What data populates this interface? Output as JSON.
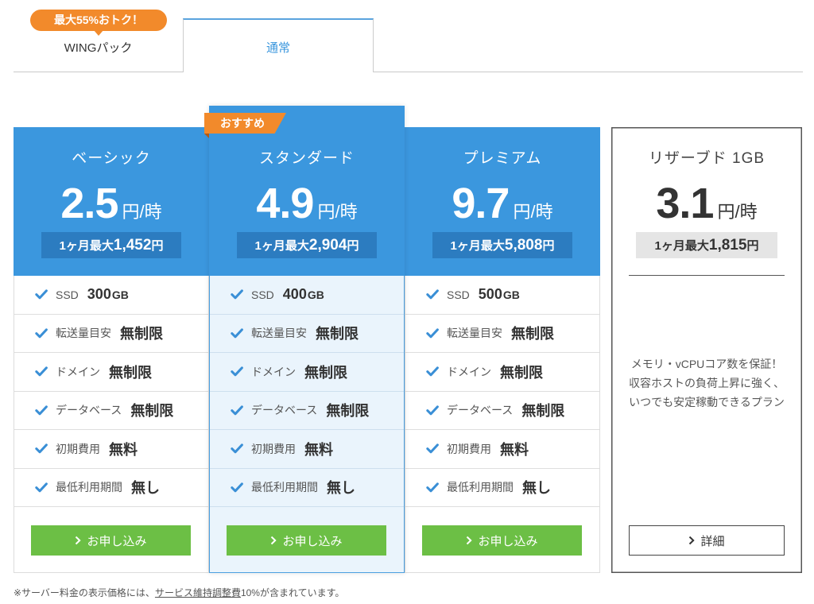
{
  "tabs": [
    {
      "label": "WINGパック",
      "badge": "最大55%おトク！",
      "selected": false
    },
    {
      "label": "通常",
      "selected": true
    }
  ],
  "recommend_label": "おすすめ",
  "plans": [
    {
      "name": "ベーシック",
      "price": "2.5",
      "price_unit": "円/時",
      "monthly_prefix": "1ヶ月最大",
      "monthly_amount": "1,452",
      "monthly_suffix": "円",
      "features": [
        {
          "label": "SSD",
          "value": "300",
          "unit": "GB"
        },
        {
          "label": "転送量目安",
          "value": "無制限"
        },
        {
          "label": "ドメイン",
          "value": "無制限"
        },
        {
          "label": "データベース",
          "value": "無制限"
        },
        {
          "label": "初期費用",
          "value": "無料"
        },
        {
          "label": "最低利用期間",
          "value": "無し"
        }
      ],
      "button_label": "お申し込み"
    },
    {
      "name": "スタンダード",
      "price": "4.9",
      "price_unit": "円/時",
      "monthly_prefix": "1ヶ月最大",
      "monthly_amount": "2,904",
      "monthly_suffix": "円",
      "recommended": true,
      "features": [
        {
          "label": "SSD",
          "value": "400",
          "unit": "GB"
        },
        {
          "label": "転送量目安",
          "value": "無制限"
        },
        {
          "label": "ドメイン",
          "value": "無制限"
        },
        {
          "label": "データベース",
          "value": "無制限"
        },
        {
          "label": "初期費用",
          "value": "無料"
        },
        {
          "label": "最低利用期間",
          "value": "無し"
        }
      ],
      "button_label": "お申し込み"
    },
    {
      "name": "プレミアム",
      "price": "9.7",
      "price_unit": "円/時",
      "monthly_prefix": "1ヶ月最大",
      "monthly_amount": "5,808",
      "monthly_suffix": "円",
      "features": [
        {
          "label": "SSD",
          "value": "500",
          "unit": "GB"
        },
        {
          "label": "転送量目安",
          "value": "無制限"
        },
        {
          "label": "ドメイン",
          "value": "無制限"
        },
        {
          "label": "データベース",
          "value": "無制限"
        },
        {
          "label": "初期費用",
          "value": "無料"
        },
        {
          "label": "最低利用期間",
          "value": "無し"
        }
      ],
      "button_label": "お申し込み"
    }
  ],
  "reserved": {
    "name": "リザーブド 1GB",
    "price": "3.1",
    "price_unit": "円/時",
    "monthly_prefix": "1ヶ月最大",
    "monthly_amount": "1,815",
    "monthly_suffix": "円",
    "description": "メモリ・vCPUコア数を保証！収容ホストの負荷上昇に強く、いつでも安定稼動できるプラン",
    "button_label": "詳細"
  },
  "footer": {
    "prefix": "※サーバー料金の表示価格には、",
    "link": "サービス維持調整費",
    "suffix": "10%が含まれています。"
  },
  "icons": {
    "feature_check": "check-icon",
    "button_arrow": "chevron-right-icon"
  },
  "colors": {
    "header_blue": "#3b97de",
    "monthly_badge_blue": "#2c7cc0",
    "cta_green": "#6cbf45",
    "badge_orange": "#f28a2b",
    "featured_bg": "#eaf4fc"
  }
}
